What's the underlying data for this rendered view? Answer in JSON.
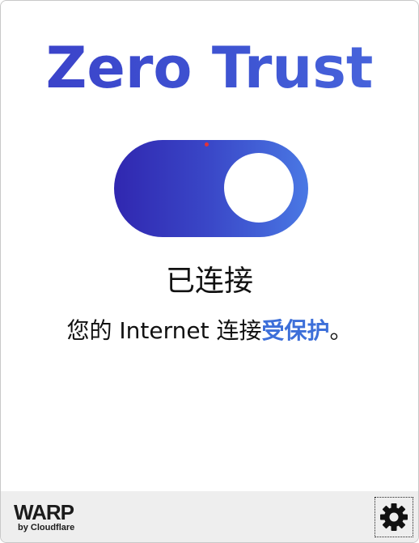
{
  "app": {
    "title": "Zero Trust"
  },
  "toggle": {
    "state": "on",
    "accent_start": "#3027b0",
    "accent_end": "#4a78e4"
  },
  "status": {
    "label": "已连接",
    "message_prefix": "您的 Internet 连接",
    "message_highlight": "受保护",
    "message_suffix": "。",
    "highlight_color": "#3d6fd9"
  },
  "footer": {
    "brand": "WARP",
    "brand_sub": "by Cloudflare",
    "settings_icon": "gear-icon"
  }
}
